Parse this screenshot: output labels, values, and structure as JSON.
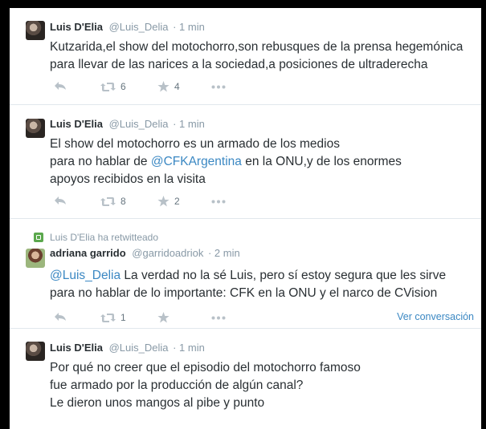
{
  "tweets": [
    {
      "name": "Luis D'Elia",
      "handle": "@Luis_Delia",
      "time": "· 1 min",
      "lines": [
        "Kutzarida,el show del motochorro,son rebusques de la prensa hegemónica",
        "para llevar de las narices a la sociedad,a posiciones de ultraderecha"
      ],
      "retweets": "6",
      "favorites": "4"
    },
    {
      "name": "Luis D'Elia",
      "handle": "@Luis_Delia",
      "time": "· 1 min",
      "line1": "El show del motochorro es un armado de los medios",
      "line2_pre": "para no hablar de ",
      "line2_link": "@CFKArgentina",
      "line2_post": " en la ONU,y de los enormes",
      "line3": "apoyos recibidos en la visita",
      "retweets": "8",
      "favorites": "2"
    },
    {
      "context": "Luis D'Elia ha retwitteado",
      "name": "adriana garrido",
      "handle": "@garridoadriok",
      "time": "· 2 min",
      "mention": "@Luis_Delia",
      "line1_rest": " La verdad no la sé Luis, pero sí estoy segura que les sirve",
      "line2": "para no hablar de lo importante: CFK en la ONU y el narco de CVision",
      "retweets": "1",
      "view_conversation": "Ver conversación"
    },
    {
      "name": "Luis D'Elia",
      "handle": "@Luis_Delia",
      "time": "· 1 min",
      "lines": [
        "Por qué no creer que el episodio del motochorro famoso",
        "fue armado por la producción de algún canal?",
        "Le dieron unos mangos al pibe y punto"
      ]
    }
  ],
  "icons": {
    "reply": "reply-icon",
    "retweet": "retweet-icon",
    "favorite": "star-icon",
    "more": "more-icon"
  },
  "colors": {
    "link": "#3b88c3",
    "muted": "#8899a6",
    "retweet_badge": "#5ba84d"
  }
}
